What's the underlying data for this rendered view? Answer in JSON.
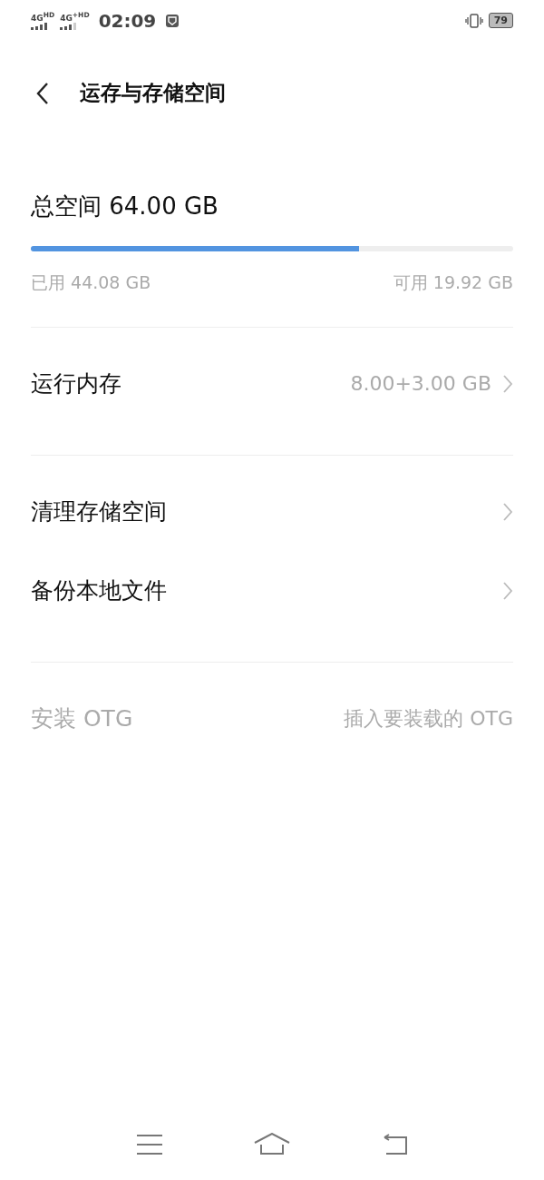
{
  "status_bar": {
    "signals": [
      "4G$^{HD}$",
      "4G$^{+HD}$"
    ],
    "time": "02:09",
    "battery": "79"
  },
  "header": {
    "title": "运存与存储空间"
  },
  "storage": {
    "total": "总空间 64.00 GB",
    "level": 0.68,
    "used": "已用 44.08 GB",
    "free": "可用 19.92 GB"
  },
  "sections": [
    {
      "rows": [
        {
          "label": "运行内存",
          "value": "8.00+3.00 GB",
          "chevron": true,
          "disabled": false
        }
      ]
    },
    {
      "rows": [
        {
          "label": "清理存储空间",
          "chevron": true,
          "disabled": false
        },
        {
          "label": "备份本地文件",
          "chevron": true,
          "disabled": false
        }
      ]
    },
    {
      "rows": [
        {
          "label": "安装 OTG",
          "value": "插入要装载的 OTG",
          "chevron": false,
          "disabled": true
        }
      ]
    }
  ]
}
